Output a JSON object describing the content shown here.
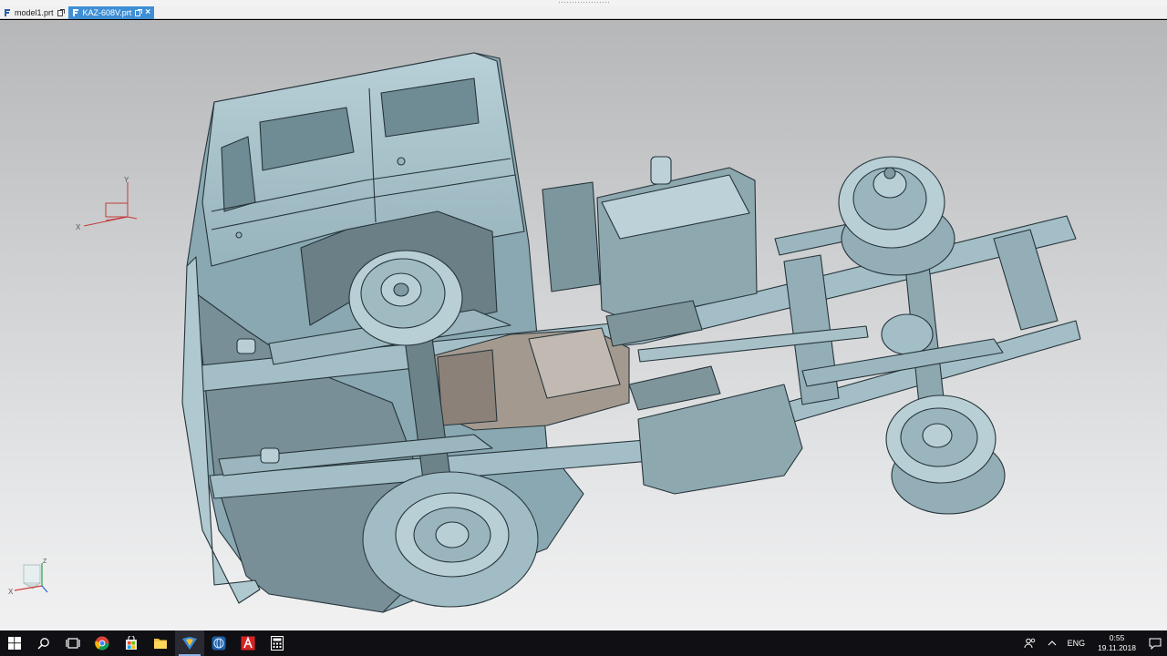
{
  "tabs": [
    {
      "label": "model1.prt",
      "active": false,
      "icon": "nx-logo-icon",
      "ctrl_icon": "popout-icon"
    },
    {
      "label": "KAZ-608V.prt",
      "active": true,
      "icon": "nx-logo-icon",
      "ctrl_icon": "popout-icon",
      "close_icon": "close-icon"
    }
  ],
  "viewport": {
    "model_color": "#a9c4cc",
    "model_shadow": "#7f9ea8",
    "dark_parts": "#5e6d73",
    "engine_color": "#9a8f86"
  },
  "triad": {
    "x_label": "X",
    "y_label": "Y",
    "x_color": "#d23b3b",
    "y_color": "#c23c3c"
  },
  "mini_triad": {
    "x_label": "X",
    "z_label": "Z"
  },
  "taskbar": {
    "apps": [
      {
        "name": "start",
        "icon": "windows-start-icon"
      },
      {
        "name": "search",
        "icon": "search-icon"
      },
      {
        "name": "task-view",
        "icon": "task-view-icon"
      },
      {
        "name": "chrome",
        "icon": "chrome-icon"
      },
      {
        "name": "store",
        "icon": "store-icon"
      },
      {
        "name": "explorer",
        "icon": "folder-icon"
      },
      {
        "name": "nx",
        "icon": "nx-icon",
        "active": true
      },
      {
        "name": "app-blue",
        "icon": "globe-icon"
      },
      {
        "name": "autocad",
        "icon": "autocad-icon"
      },
      {
        "name": "calculator",
        "icon": "calculator-icon"
      }
    ],
    "tray": {
      "people_icon": "people-icon",
      "chevron_icon": "chevron-up-icon",
      "lang": "ENG",
      "time": "0:55",
      "date": "19.11.2018",
      "notification_icon": "notification-icon"
    }
  }
}
